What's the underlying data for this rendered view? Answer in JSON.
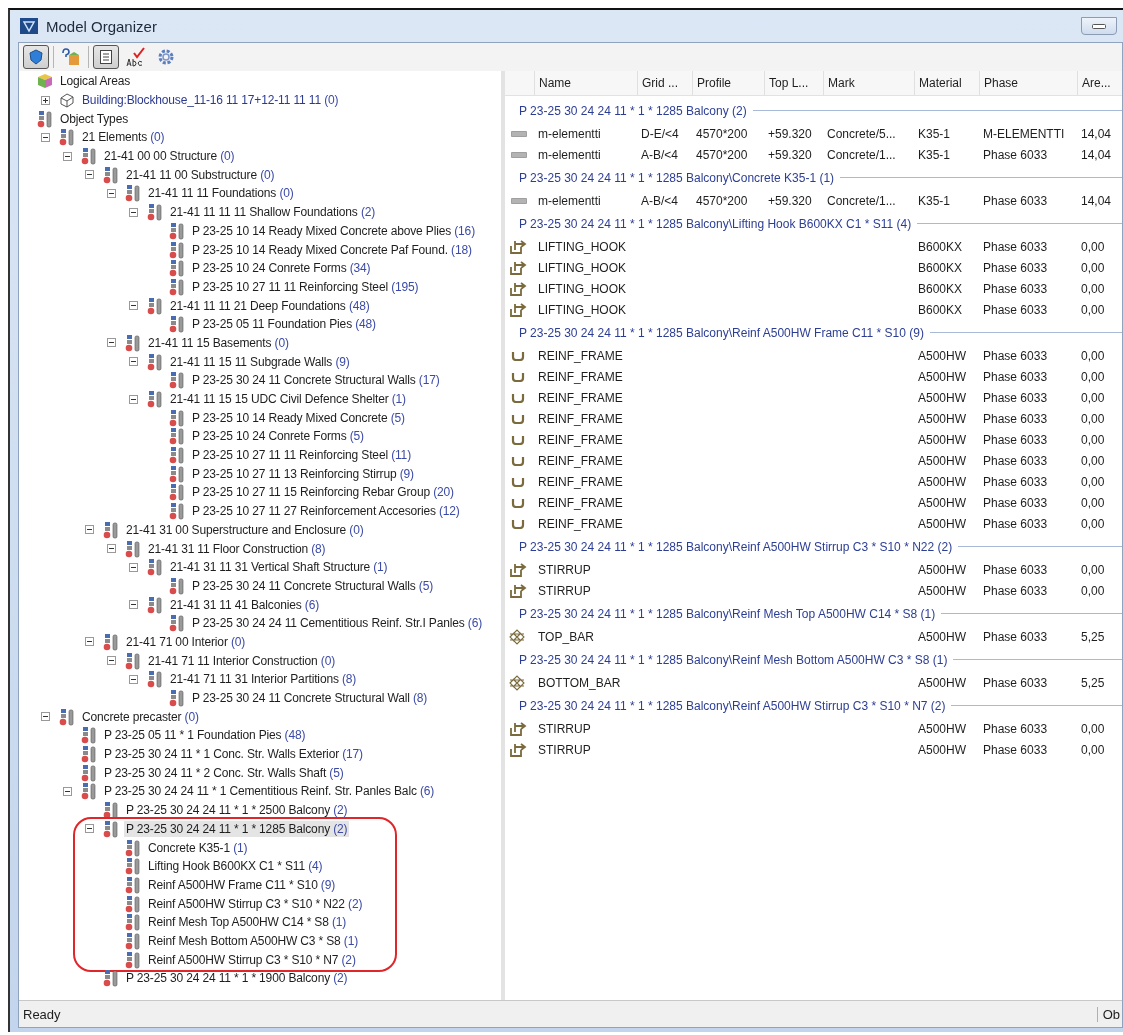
{
  "window": {
    "title": "Model Organizer"
  },
  "toolbar": [
    {
      "kind": "shield",
      "pressed": true
    },
    {
      "kind": "help",
      "pressed": false
    },
    {
      "kind": "list",
      "pressed": true
    },
    {
      "kind": "spell",
      "pressed": false
    },
    {
      "kind": "gear",
      "pressed": false
    }
  ],
  "tree": [
    {
      "label": "Logical Areas",
      "kind": "area",
      "selected": false,
      "children": [
        {
          "label": "Building:Blockhouse_11-16 11 17+12-11 11 11",
          "count": "(0)",
          "kind": "building",
          "expanded": false,
          "selected": false
        }
      ]
    },
    {
      "label": "Object Types",
      "kind": "type",
      "selected": false,
      "children": [
        {
          "label": "21 Elements",
          "count": "(0)",
          "kind": "type",
          "expanded": true,
          "selected": false,
          "children": [
            {
              "label": "21-41 00 00 Structure",
              "count": "(0)",
              "kind": "type",
              "expanded": true,
              "selected": false,
              "children": [
                {
                  "label": "21-41 11 00 Substructure",
                  "count": "(0)",
                  "kind": "type",
                  "expanded": true,
                  "selected": false,
                  "children": [
                    {
                      "label": "21-41 11 11 Foundations",
                      "count": "(0)",
                      "kind": "type",
                      "expanded": true,
                      "selected": false,
                      "children": [
                        {
                          "label": "21-41 11 11 11 Shallow Foundations",
                          "count": "(2)",
                          "kind": "type",
                          "expanded": true,
                          "selected": false,
                          "children": [
                            {
                              "label": "P 23-25 10 14 Ready Mixed Concrete above Plies",
                              "count": "(16)",
                              "kind": "type",
                              "selected": false
                            },
                            {
                              "label": "P 23-25 10 14 Ready Mixed Concrete Paf Found.",
                              "count": "(18)",
                              "kind": "type",
                              "selected": false
                            },
                            {
                              "label": "P 23-25 10 24 Conrete Forms",
                              "count": "(34)",
                              "kind": "type",
                              "selected": false
                            },
                            {
                              "label": "P 23-25 10 27 11 11 Reinforcing Steel",
                              "count": "(195)",
                              "kind": "type",
                              "selected": false
                            }
                          ]
                        },
                        {
                          "label": "21-41 11 11 21 Deep Foundations",
                          "count": "(48)",
                          "kind": "type",
                          "expanded": true,
                          "selected": false,
                          "children": [
                            {
                              "label": "P 23-25 05 11 Foundation Pies",
                              "count": "(48)",
                              "kind": "type",
                              "selected": false
                            }
                          ]
                        }
                      ]
                    },
                    {
                      "label": "21-41 11 15 Basements",
                      "count": "(0)",
                      "kind": "type",
                      "expanded": true,
                      "selected": false,
                      "children": [
                        {
                          "label": "21-41 11 15 11 Subgrade Walls",
                          "count": "(9)",
                          "kind": "type",
                          "expanded": true,
                          "selected": false,
                          "children": [
                            {
                              "label": "P 23-25 30 24 11 Concrete Structural Walls",
                              "count": "(17)",
                              "kind": "type",
                              "selected": false
                            }
                          ]
                        },
                        {
                          "label": "21-41 11 15 15 UDC Civil Defence Shelter",
                          "count": "(1)",
                          "kind": "type",
                          "expanded": true,
                          "selected": false,
                          "children": [
                            {
                              "label": "P 23-25 10 14 Ready Mixed Concrete",
                              "count": "(5)",
                              "kind": "type",
                              "selected": false
                            },
                            {
                              "label": "P 23-25 10 24 Conrete Forms",
                              "count": "(5)",
                              "kind": "type",
                              "selected": false
                            },
                            {
                              "label": "P 23-25 10 27 11 11 Reinforcing Steel",
                              "count": "(11)",
                              "kind": "type",
                              "selected": false
                            },
                            {
                              "label": "P 23-25 10 27 11 13 Reinforcing Stirrup",
                              "count": "(9)",
                              "kind": "type",
                              "selected": false
                            },
                            {
                              "label": "P 23-25 10 27 11 15 Reinforcing Rebar Group",
                              "count": "(20)",
                              "kind": "type",
                              "selected": false
                            },
                            {
                              "label": "P 23-25 10 27 11 27 Reinforcement Accesories",
                              "count": "(12)",
                              "kind": "type",
                              "selected": false
                            }
                          ]
                        }
                      ]
                    }
                  ]
                },
                {
                  "label": "21-41 31 00 Superstructure and Enclosure",
                  "count": "(0)",
                  "kind": "type",
                  "expanded": true,
                  "selected": false,
                  "children": [
                    {
                      "label": "21-41 31 11 Floor Construction",
                      "count": "(8)",
                      "kind": "type",
                      "expanded": true,
                      "selected": false,
                      "children": [
                        {
                          "label": "21-41 31 11 31 Vertical Shaft Structure",
                          "count": "(1)",
                          "kind": "type",
                          "expanded": true,
                          "selected": false,
                          "children": [
                            {
                              "label": "P 23-25 30 24 11 Concrete Structural Walls",
                              "count": "(5)",
                              "kind": "type",
                              "selected": false
                            }
                          ]
                        },
                        {
                          "label": "21-41 31 11 41 Balconies",
                          "count": "(6)",
                          "kind": "type",
                          "expanded": true,
                          "selected": false,
                          "children": [
                            {
                              "label": "P 23-25 30 24 24 11 Cementitious Reinf. Str.I Panles",
                              "count": "(6)",
                              "kind": "type",
                              "selected": false
                            }
                          ]
                        }
                      ]
                    }
                  ]
                },
                {
                  "label": "21-41 71 00 Interior",
                  "count": "(0)",
                  "kind": "type",
                  "expanded": true,
                  "selected": false,
                  "children": [
                    {
                      "label": "21-41 71 11 Interior Construction",
                      "count": "(0)",
                      "kind": "type",
                      "expanded": true,
                      "selected": false,
                      "children": [
                        {
                          "label": "21-41 71 11 31 Interior Partitions",
                          "count": "(8)",
                          "kind": "type",
                          "expanded": true,
                          "selected": false,
                          "children": [
                            {
                              "label": "P 23-25 30 24 11 Concrete Structural Wall",
                              "count": "(8)",
                              "kind": "type",
                              "selected": false
                            }
                          ]
                        }
                      ]
                    }
                  ]
                }
              ]
            }
          ]
        },
        {
          "label": "Concrete precaster",
          "count": "(0)",
          "kind": "type",
          "expanded": true,
          "selected": false,
          "children": [
            {
              "label": "P 23-25 05 11 * 1 Foundation Pies",
              "count": "(48)",
              "kind": "type",
              "selected": false
            },
            {
              "label": "P 23-25 30 24 11 * 1 Conc. Str. Walls Exterior",
              "count": "(17)",
              "kind": "type",
              "selected": false
            },
            {
              "label": "P 23-25 30 24 11 * 2 Conc. Str. Walls Shaft",
              "count": "(5)",
              "kind": "type",
              "selected": false
            },
            {
              "label": "P 23-25 30 24 24 11 * 1 Cementitious Reinf. Str. Panles Balc",
              "count": "(6)",
              "kind": "type",
              "expanded": true,
              "selected": false,
              "children": [
                {
                  "label": "P 23-25 30 24 24 11 * 1 * 2500 Balcony",
                  "count": "(2)",
                  "kind": "type",
                  "selected": false
                },
                {
                  "label": "P 23-25 30 24 24 11 * 1 * 1285 Balcony",
                  "count": "(2)",
                  "kind": "type",
                  "expanded": true,
                  "selected": true,
                  "annotated": true,
                  "children": [
                    {
                      "label": "Concrete K35-1",
                      "count": "(1)",
                      "kind": "type",
                      "selected": false
                    },
                    {
                      "label": "Lifting Hook B600KX C1 * S11",
                      "count": "(4)",
                      "kind": "type",
                      "selected": false
                    },
                    {
                      "label": "Reinf A500HW Frame C11 * S10",
                      "count": "(9)",
                      "kind": "type",
                      "selected": false
                    },
                    {
                      "label": "Reinf A500HW Stirrup C3 * S10 * N22",
                      "count": "(2)",
                      "kind": "type",
                      "selected": false
                    },
                    {
                      "label": "Reinf Mesh Top A500HW C14 * S8",
                      "count": "(1)",
                      "kind": "type",
                      "selected": false
                    },
                    {
                      "label": "Reinf Mesh Bottom A500HW C3 * S8",
                      "count": "(1)",
                      "kind": "type",
                      "selected": false
                    },
                    {
                      "label": "Reinf A500HW Stirrup C3 * S10 * N7",
                      "count": "(2)",
                      "kind": "type",
                      "selected": false
                    }
                  ]
                },
                {
                  "label": "P 23-25 30 24 24 11 * 1 * 1900 Balcony",
                  "count": "(2)",
                  "kind": "type",
                  "selected": false
                }
              ]
            }
          ]
        }
      ]
    }
  ],
  "list": {
    "columns": [
      "Name",
      "Grid ...",
      "Profile",
      "Top L...",
      "Mark",
      "Material",
      "Phase",
      "Are..."
    ],
    "groups": [
      {
        "title": "P 23-25 30 24 24 11 * 1 * 1285 Balcony (2)",
        "rows": [
          {
            "kind": "plate",
            "name": "m-elementti",
            "grid": "D-E/<4",
            "profile": "4570*200",
            "top_level": "+59.320",
            "mark": "Concrete/5...",
            "material": "K35-1",
            "phase": "M-ELEMENTTI",
            "area": "14,04"
          },
          {
            "kind": "plate",
            "name": "m-elementti",
            "grid": "A-B/<4",
            "profile": "4570*200",
            "top_level": "+59.320",
            "mark": "Concrete/1...",
            "material": "K35-1",
            "phase": "Phase 6033",
            "area": "14,04"
          }
        ]
      },
      {
        "title": "P 23-25 30 24 24 11 * 1 * 1285 Balcony\\Concrete K35-1 (1)",
        "rows": [
          {
            "kind": "plate",
            "name": "m-elementti",
            "grid": "A-B/<4",
            "profile": "4570*200",
            "top_level": "+59.320",
            "mark": "Concrete/1...",
            "material": "K35-1",
            "phase": "Phase 6033",
            "area": "14,04"
          }
        ]
      },
      {
        "title": "P 23-25 30 24 24 11 * 1 * 1285 Balcony\\Lifting Hook B600KX C1 * S11 (4)",
        "rows": [
          {
            "kind": "hook",
            "name": "LIFTING_HOOK",
            "material": "B600KX",
            "phase": "Phase 6033",
            "area": "0,00"
          },
          {
            "kind": "hook",
            "name": "LIFTING_HOOK",
            "material": "B600KX",
            "phase": "Phase 6033",
            "area": "0,00"
          },
          {
            "kind": "hook",
            "name": "LIFTING_HOOK",
            "material": "B600KX",
            "phase": "Phase 6033",
            "area": "0,00"
          },
          {
            "kind": "hook",
            "name": "LIFTING_HOOK",
            "material": "B600KX",
            "phase": "Phase 6033",
            "area": "0,00"
          }
        ]
      },
      {
        "title": "P 23-25 30 24 24 11 * 1 * 1285 Balcony\\Reinf A500HW Frame C11 * S10 (9)",
        "rows": [
          {
            "kind": "frame",
            "name": "REINF_FRAME",
            "material": "A500HW",
            "phase": "Phase 6033",
            "area": "0,00"
          },
          {
            "kind": "frame",
            "name": "REINF_FRAME",
            "material": "A500HW",
            "phase": "Phase 6033",
            "area": "0,00"
          },
          {
            "kind": "frame",
            "name": "REINF_FRAME",
            "material": "A500HW",
            "phase": "Phase 6033",
            "area": "0,00"
          },
          {
            "kind": "frame",
            "name": "REINF_FRAME",
            "material": "A500HW",
            "phase": "Phase 6033",
            "area": "0,00"
          },
          {
            "kind": "frame",
            "name": "REINF_FRAME",
            "material": "A500HW",
            "phase": "Phase 6033",
            "area": "0,00"
          },
          {
            "kind": "frame",
            "name": "REINF_FRAME",
            "material": "A500HW",
            "phase": "Phase 6033",
            "area": "0,00"
          },
          {
            "kind": "frame",
            "name": "REINF_FRAME",
            "material": "A500HW",
            "phase": "Phase 6033",
            "area": "0,00"
          },
          {
            "kind": "frame",
            "name": "REINF_FRAME",
            "material": "A500HW",
            "phase": "Phase 6033",
            "area": "0,00"
          },
          {
            "kind": "frame",
            "name": "REINF_FRAME",
            "material": "A500HW",
            "phase": "Phase 6033",
            "area": "0,00"
          }
        ]
      },
      {
        "title": "P 23-25 30 24 24 11 * 1 * 1285 Balcony\\Reinf A500HW Stirrup C3 * S10 * N22 (2)",
        "rows": [
          {
            "kind": "hook",
            "name": "STIRRUP",
            "material": "A500HW",
            "phase": "Phase 6033",
            "area": "0,00"
          },
          {
            "kind": "hook",
            "name": "STIRRUP",
            "material": "A500HW",
            "phase": "Phase 6033",
            "area": "0,00"
          }
        ]
      },
      {
        "title": "P 23-25 30 24 24 11 * 1 * 1285 Balcony\\Reinf Mesh Top A500HW C14 * S8 (1)",
        "rows": [
          {
            "kind": "mesh",
            "name": "TOP_BAR",
            "material": "A500HW",
            "phase": "Phase 6033",
            "area": "5,25"
          }
        ]
      },
      {
        "title": "P 23-25 30 24 24 11 * 1 * 1285 Balcony\\Reinf Mesh Bottom A500HW C3 * S8 (1)",
        "rows": [
          {
            "kind": "mesh",
            "name": "BOTTOM_BAR",
            "material": "A500HW",
            "phase": "Phase 6033",
            "area": "5,25"
          }
        ]
      },
      {
        "title": "P 23-25 30 24 24 11 * 1 * 1285 Balcony\\Reinf A500HW Stirrup C3 * S10 * N7 (2)",
        "rows": [
          {
            "kind": "hook",
            "name": "STIRRUP",
            "material": "A500HW",
            "phase": "Phase 6033",
            "area": "0,00"
          },
          {
            "kind": "hook",
            "name": "STIRRUP",
            "material": "A500HW",
            "phase": "Phase 6033",
            "area": "0,00"
          }
        ]
      }
    ]
  },
  "status_bar": {
    "message": "Ready",
    "panel": "Ob"
  }
}
